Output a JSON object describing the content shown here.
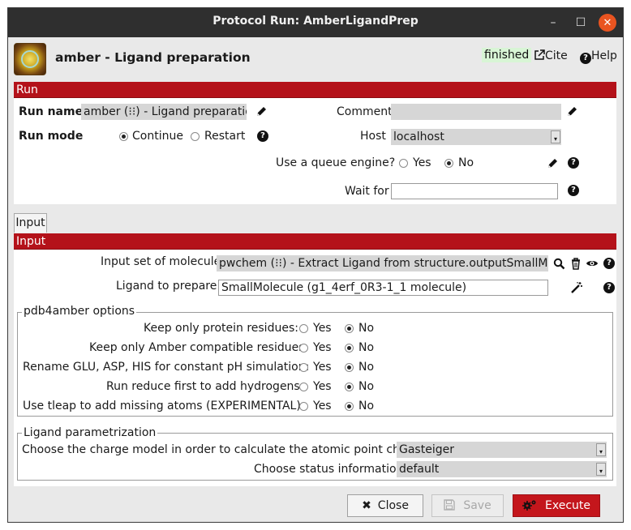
{
  "window": {
    "title": "Protocol Run: AmberLigandPrep",
    "minimize": "–",
    "maximize": "☐",
    "close": "✕"
  },
  "header": {
    "title": "amber - Ligand preparation",
    "status": "finished",
    "cite": "Cite",
    "help": "Help"
  },
  "run": {
    "section": "Run",
    "run_name_label": "Run name",
    "run_name_value": "amber (⁝⁝) - Ligand preparation",
    "comment_label": "Comment",
    "comment_value": "",
    "run_mode_label": "Run mode",
    "mode_continue": "Continue",
    "mode_restart": "Restart",
    "host_label": "Host",
    "host_value": "localhost",
    "queue_label": "Use a queue engine?",
    "yes": "Yes",
    "no": "No",
    "wait_label": "Wait for",
    "wait_value": ""
  },
  "tabs": {
    "input": "Input"
  },
  "input": {
    "section": "Input",
    "molecules_label": "Input set of molecules:",
    "molecules_value": "pwchem (⁝⁝) - Extract Ligand from structure.outputSmallMolecules",
    "ligand_label": "Ligand to prepare:",
    "ligand_value": "SmallMolecule (g1_4erf_0R3-1_1 molecule)"
  },
  "pdb4amber": {
    "legend": "pdb4amber options",
    "rows": [
      {
        "label": "Keep only protein residues:",
        "selected": "No"
      },
      {
        "label": "Keep only Amber compatible residues:",
        "selected": "No"
      },
      {
        "label": "Rename GLU, ASP, HIS for constant pH simulation:",
        "selected": "No"
      },
      {
        "label": "Run reduce first to add hydrogens:",
        "selected": "No"
      },
      {
        "label": "Use tleap to add missing atoms (EXPERIMENTAL):",
        "selected": "No"
      }
    ],
    "yes": "Yes",
    "no": "No"
  },
  "ligand_param": {
    "legend": "Ligand parametrization",
    "charge_label": "Choose the charge model in order to calculate the atomic point charges:",
    "charge_value": "Gasteiger",
    "status_label": "Choose status information:",
    "status_value": "default"
  },
  "footer": {
    "close": "Close",
    "save": "Save",
    "execute": "Execute"
  },
  "colors": {
    "section_red": "#b4121a",
    "execute_red": "#c4161c",
    "titlebar": "#2f2f2f",
    "status_green": "#d8f5d5"
  },
  "icons": [
    "pencil-icon",
    "help-circle-icon",
    "search-icon",
    "trash-icon",
    "eye-icon",
    "wand-icon",
    "external-link-icon",
    "close-x-icon",
    "save-icon",
    "gears-icon"
  ]
}
